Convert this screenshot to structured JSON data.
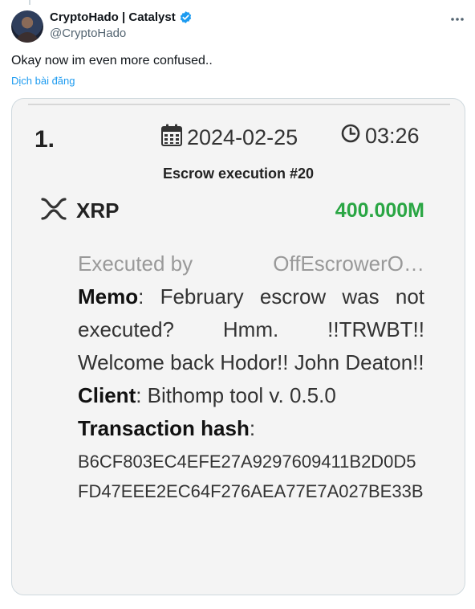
{
  "tweet": {
    "display_name": "CryptoHado | Catalyst",
    "handle": "@CryptoHado",
    "text": "Okay now im even more confused..",
    "translate": "Dịch bài đăng"
  },
  "card": {
    "rank": "1.",
    "date": "2024-02-25",
    "time": "03:26",
    "title": "Escrow execution #20",
    "asset": "XRP",
    "amount": "400.000M",
    "executed_label": "Executed by",
    "executed_value": "OffEscrowerO…",
    "memo_label": "Memo",
    "memo_text": ": February escrow was not executed? Hmm. !!TRWBT!! Welcome back Hodor!! John Deaton!!",
    "client_label": "Client",
    "client_text": ": Bithomp tool v. 0.5.0",
    "hash_label": "Transaction hash",
    "hash_colon": ":",
    "hash_value": "B6CF803EC4EFE27A9297609411B2D0D5FD47EEE2EC64F276AEA77E7A027BE33B"
  },
  "colors": {
    "verified": "#1d9bf0",
    "amount": "#2aa644",
    "link": "#1d9bf0"
  },
  "icons": [
    "verified-badge-icon",
    "more-options-icon",
    "calendar-icon",
    "clock-icon",
    "xrp-logo-icon"
  ]
}
